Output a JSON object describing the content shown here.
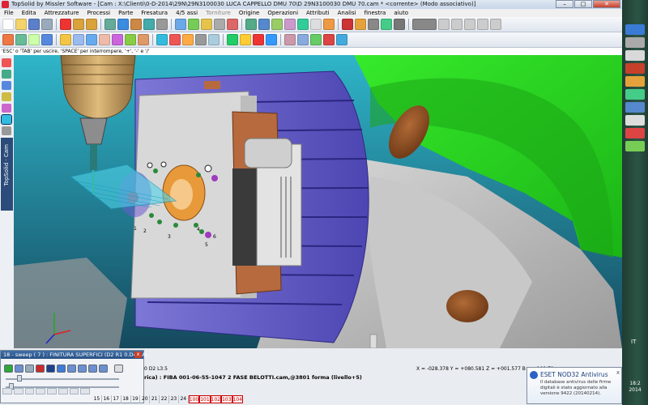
{
  "window": {
    "title": "TopSolid by Missler Software - [Cam : X:\\Clienti\\0-D-2014\\29N\\29N3100030 LUCA CAPPELLO DMU 70\\D 29N3100030 DMU 70.cam * <corrente> (Modo associativo)]",
    "minimize": "–",
    "maximize": "□",
    "close": "✕"
  },
  "menu": [
    "File",
    "Edita",
    "Attrezzature",
    "Processi",
    "Parte",
    "Fresatura",
    "4/5 assi",
    "Torniture",
    "Origine",
    "Operazioni",
    "Attributi",
    "Analisi",
    "finestra",
    "aiuto"
  ],
  "hint": "'ESC' o 'TAB' per uscire, 'SPACE' per interrompere, '+', '-' e '/'",
  "left_panel": {
    "vertical_label": "TopSolid · Cam"
  },
  "viewport": {
    "part_numbers": [
      "1",
      "2",
      "3",
      "4",
      "5",
      "6"
    ]
  },
  "sweep_dialog": {
    "title": "18 - sweep ( 7 ) : FINITURA SUPERFICI   (D2 R1 0.D4 CAL ...",
    "close": "x"
  },
  "status": {
    "prev_line": "0  D2  L3.5",
    "cmd_prefix": "rica)",
    "cmd": ": FIBA 001-06-55-1047 2 FASE BELOTTI.cam,@3801 forma (livello+5)",
    "coords": "X = -028.378   Y = +080.581   Z = +001.577   B = +109.7?"
  },
  "ruler": [
    "15",
    "16",
    "17",
    "18",
    "19",
    "20",
    "21",
    "22",
    "23",
    "24",
    "100",
    "101",
    "102",
    "103",
    "104"
  ],
  "notification": {
    "title": "ESET NOD32 Antivirus",
    "body": "Il database antivirus delle firme digitali è stato aggiornato alla versione 9422 (20140214).",
    "close": "x"
  },
  "taskbar": {
    "lang": "IT",
    "time": "18:2",
    "date": "2014"
  },
  "colors": {
    "background_cyan": "#2fb5c9",
    "machine_green": "#29e01e",
    "table_blue": "#6a63c9",
    "fixture_white": "#dcdcdc",
    "copper": "#b76a3e",
    "spindle_gold": "#c59a5a"
  }
}
